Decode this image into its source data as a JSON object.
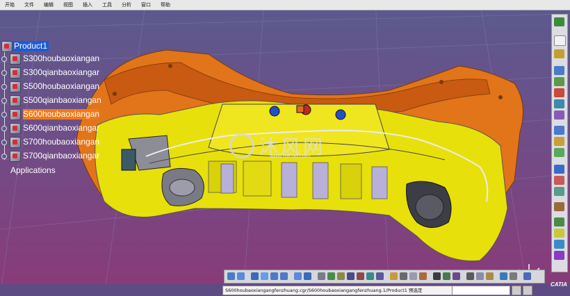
{
  "menubar": {
    "items": [
      "开始",
      "文件",
      "编辑",
      "视图",
      "插入",
      "工具",
      "分析",
      "窗口",
      "帮助"
    ]
  },
  "tree": {
    "root": "Product1",
    "items": [
      {
        "label": "S300houbaoxiangan",
        "selected": false
      },
      {
        "label": "S300qianbaoxiangar",
        "selected": false
      },
      {
        "label": "S500houbaoxiangan",
        "selected": false
      },
      {
        "label": "S500qianbaoxiangan",
        "selected": false
      },
      {
        "label": "S600houbaoxiangan",
        "selected": true
      },
      {
        "label": "S600qianbaoxiangar",
        "selected": false
      },
      {
        "label": "S700houbaoxiangan",
        "selected": false
      },
      {
        "label": "S700qianbaoxiangar",
        "selected": false
      }
    ],
    "applications": "Applications"
  },
  "watermark": {
    "text": "沐风网",
    "url": "www.mfcad.com"
  },
  "statusbar": {
    "text": "S600houbaoxiangangfenzhuang.cgr/S600houbaoxiangangfenzhuang.1/Product1 预选定"
  },
  "logo": "CATIA",
  "colors": {
    "bumper_outer": "#e2741a",
    "bumper_inner": "#e8e00a",
    "selection": "#f07a1a",
    "root_highlight": "#1e5bd1",
    "background_top": "#5a5a8e",
    "background_bottom": "#8a3a78"
  }
}
